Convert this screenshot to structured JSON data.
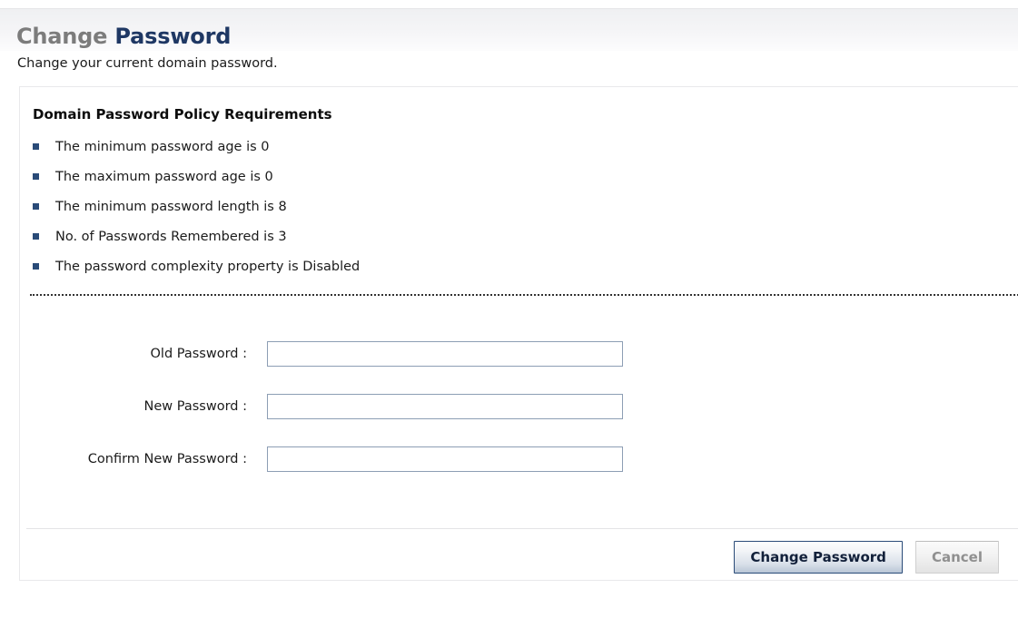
{
  "title": {
    "part1": "Change",
    "part2": "Password",
    "subtitle": "Change your current domain password."
  },
  "colors": {
    "title_light": "#7c7c7c",
    "title_dark": "#1f3864",
    "bullet": "#2a4b78",
    "input_border": "#8d9eb4",
    "primary_button_border": "#2a4b78",
    "disabled_text": "#909090"
  },
  "policy": {
    "heading": "Domain Password Policy Requirements",
    "items": [
      {
        "bullet_icon": "square-bullet-icon",
        "text": "The minimum password age is 0"
      },
      {
        "bullet_icon": "square-bullet-icon",
        "text": "The maximum password age is 0"
      },
      {
        "bullet_icon": "square-bullet-icon",
        "text": "The minimum password length is 8"
      },
      {
        "bullet_icon": "square-bullet-icon",
        "text": "No. of Passwords Remembered is 3"
      },
      {
        "bullet_icon": "square-bullet-icon",
        "text": "The password complexity property is Disabled"
      }
    ]
  },
  "form": {
    "fields": [
      {
        "label": "Old Password :",
        "value": "",
        "placeholder": ""
      },
      {
        "label": "New Password :",
        "value": "",
        "placeholder": ""
      },
      {
        "label": "Confirm New Password :",
        "value": "",
        "placeholder": ""
      }
    ]
  },
  "actions": {
    "submit_label": "Change Password",
    "cancel_label": "Cancel"
  }
}
